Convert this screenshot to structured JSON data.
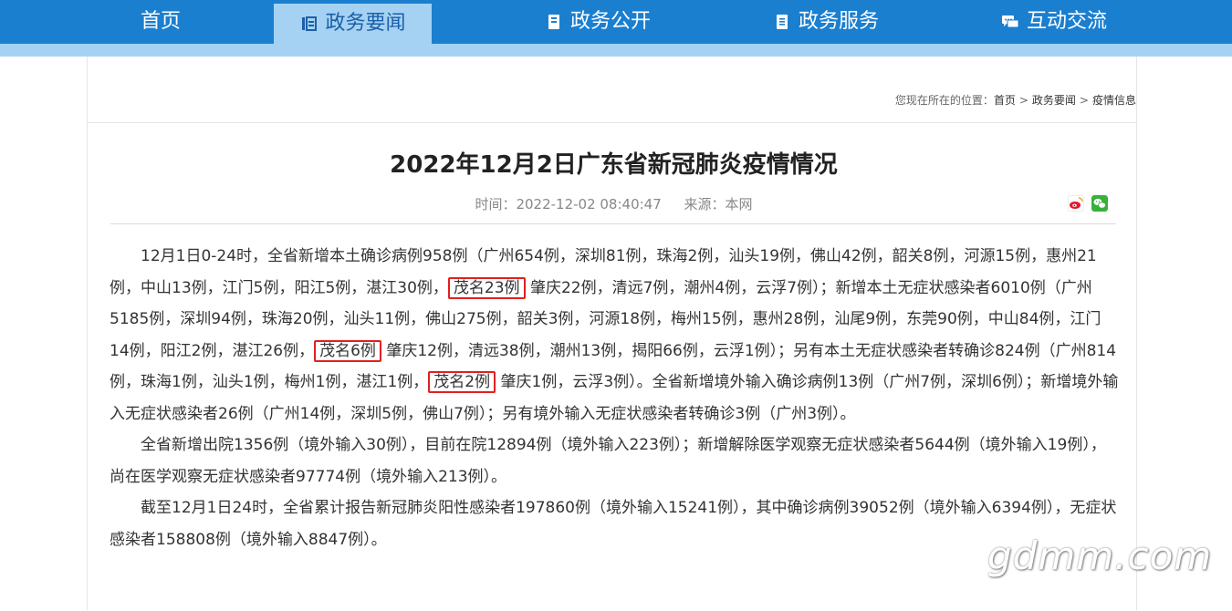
{
  "nav": {
    "items": [
      {
        "label": "首页",
        "icon": ""
      },
      {
        "label": "政务要闻",
        "icon": "news-list-icon",
        "active": true
      },
      {
        "label": "政务公开",
        "icon": "book-icon"
      },
      {
        "label": "政务服务",
        "icon": "document-icon"
      },
      {
        "label": "互动交流",
        "icon": "chat-bubbles-icon"
      }
    ]
  },
  "breadcrumb": {
    "prefix": "您现在所在的位置：",
    "items": [
      "首页",
      "政务要闻",
      "疫情信息"
    ],
    "separator": ">"
  },
  "article": {
    "title": "2022年12月2日广东省新冠肺炎疫情情况",
    "time_label": "时间：2022-12-02 08:40:47",
    "source_label": "来源：本网",
    "share_icons": [
      "weibo-icon",
      "wechat-icon"
    ],
    "p1": {
      "a": "12月1日0-24时，全省新增本土确诊病例958例（广州654例，深圳81例，珠海2例，汕头19例，佛山42例，韶关8例，河源15例，惠州21例，中山13例，江门5例，阳江5例，湛江30例，",
      "m1": "茂名23例",
      "b": "肇庆22例，清远7例，潮州4例，云浮7例）；新增本土无症状感染者6010例（广州5185例，深圳94例，珠海20例，汕头11例，佛山275例，韶关3例，河源18例，梅州15例，惠州28例，汕尾9例，东莞90例，中山84例，江门14例，阳江2例，湛江26例，",
      "m2": "茂名6例",
      "c": "肇庆12例，清远38例，潮州13例，揭阳66例，云浮1例）；另有本土无症状感染者转确诊824例（广州814例，珠海1例，汕头1例，梅州1例，湛江1例，",
      "m3": "茂名2例",
      "d": "肇庆1例，云浮3例）。全省新增境外输入确诊病例13例（广州7例，深圳6例）；新增境外输入无症状感染者26例（广州14例，深圳5例，佛山7例）；另有境外输入无症状感染者转确诊3例（广州3例）。"
    },
    "p2": "全省新增出院1356例（境外输入30例），目前在院12894例（境外输入223例）；新增解除医学观察无症状感染者5644例（境外输入19例），尚在医学观察无症状感染者97774例（境外输入213例）。",
    "p3": "截至12月1日24时，全省累计报告新冠肺炎阳性感染者197860例（境外输入15241例），其中确诊病例39052例（境外输入6394例），无症状感染者158808例（境外输入8847例）。"
  },
  "watermark": "gdmm.com",
  "colors": {
    "nav_bg": "#1b7fd0",
    "nav_active_bg": "#a5d2f3",
    "highlight_border": "#e02020"
  }
}
